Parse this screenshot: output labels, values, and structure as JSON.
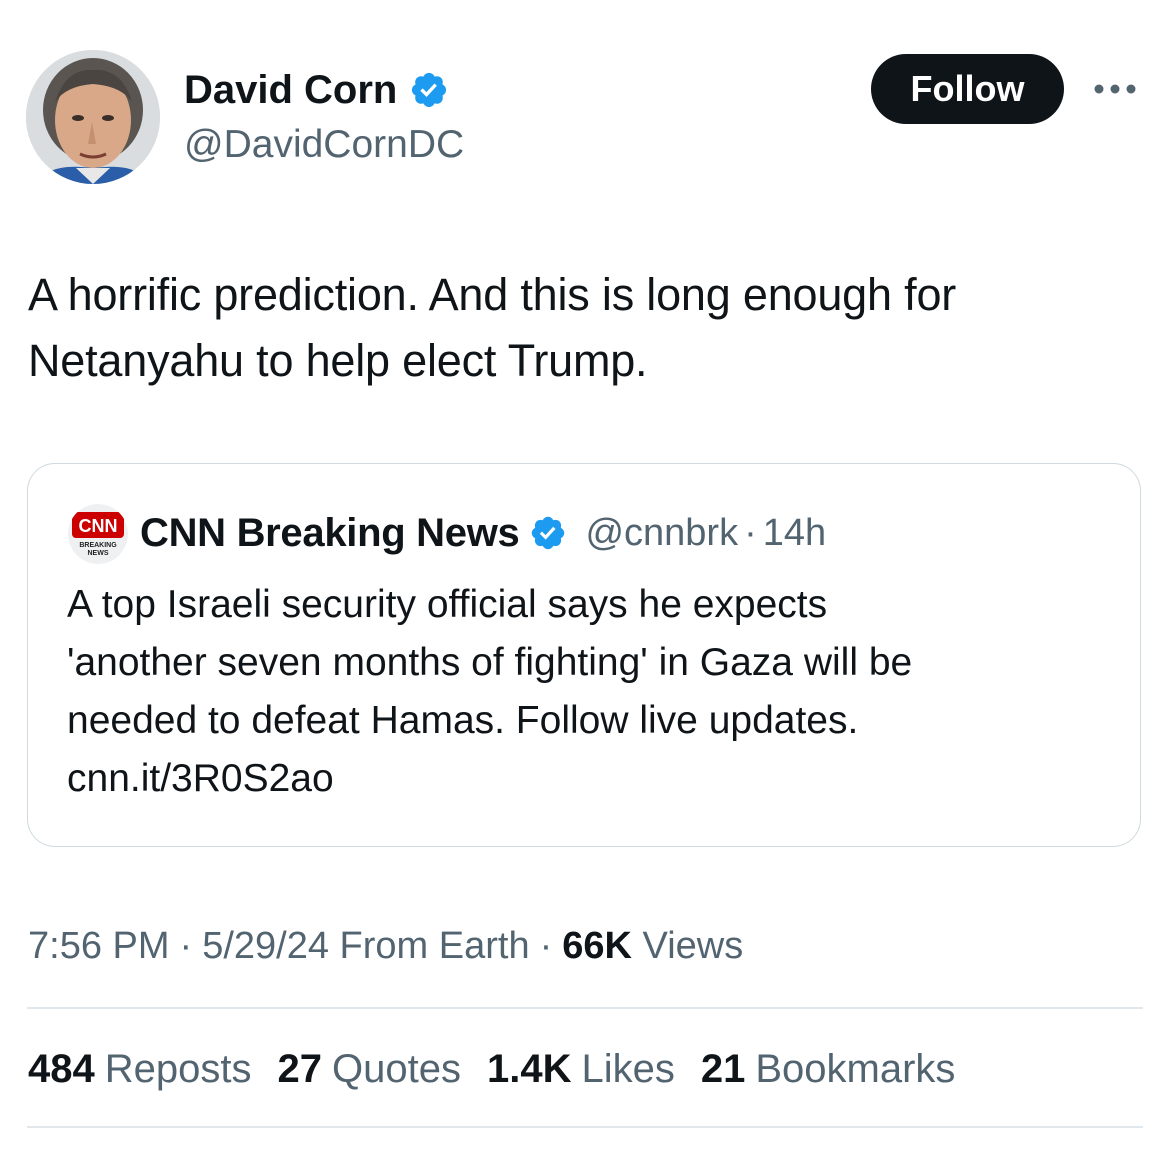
{
  "author": {
    "name": "David Corn",
    "handle": "@DavidCornDC",
    "verified_color": "#1d9bf0"
  },
  "header": {
    "follow_label": "Follow",
    "more_icon": "more-horizontal-icon"
  },
  "tweet": {
    "text_line1": "A horrific prediction. And this is long enough for",
    "text_line2": "Netanyahu to help elect Trump."
  },
  "quote": {
    "logo_text": "CNN",
    "logo_sub1": "BREAKING",
    "logo_sub2": "NEWS",
    "name": "CNN Breaking News",
    "handle": "@cnnbrk",
    "separator": "·",
    "time": "14h",
    "text_line1": "A top Israeli security official says he expects",
    "text_line2": "'another seven months of fighting' in Gaza will be",
    "text_line3": "needed to defeat Hamas. Follow live updates.",
    "text_line4": "cnn.it/3R0S2ao"
  },
  "meta": {
    "time": "7:56 PM",
    "date": "5/29/24",
    "source": "From Earth",
    "separator": "·",
    "views_count": "66K",
    "views_label": "Views"
  },
  "stats": [
    {
      "count": "484",
      "label": "Reposts"
    },
    {
      "count": "27",
      "label": "Quotes"
    },
    {
      "count": "1.4K",
      "label": "Likes"
    },
    {
      "count": "21",
      "label": "Bookmarks"
    }
  ],
  "colors": {
    "text_primary": "#0f1419",
    "text_secondary": "#536471",
    "border": "#cfd9de",
    "cnn_red": "#cc0000"
  }
}
